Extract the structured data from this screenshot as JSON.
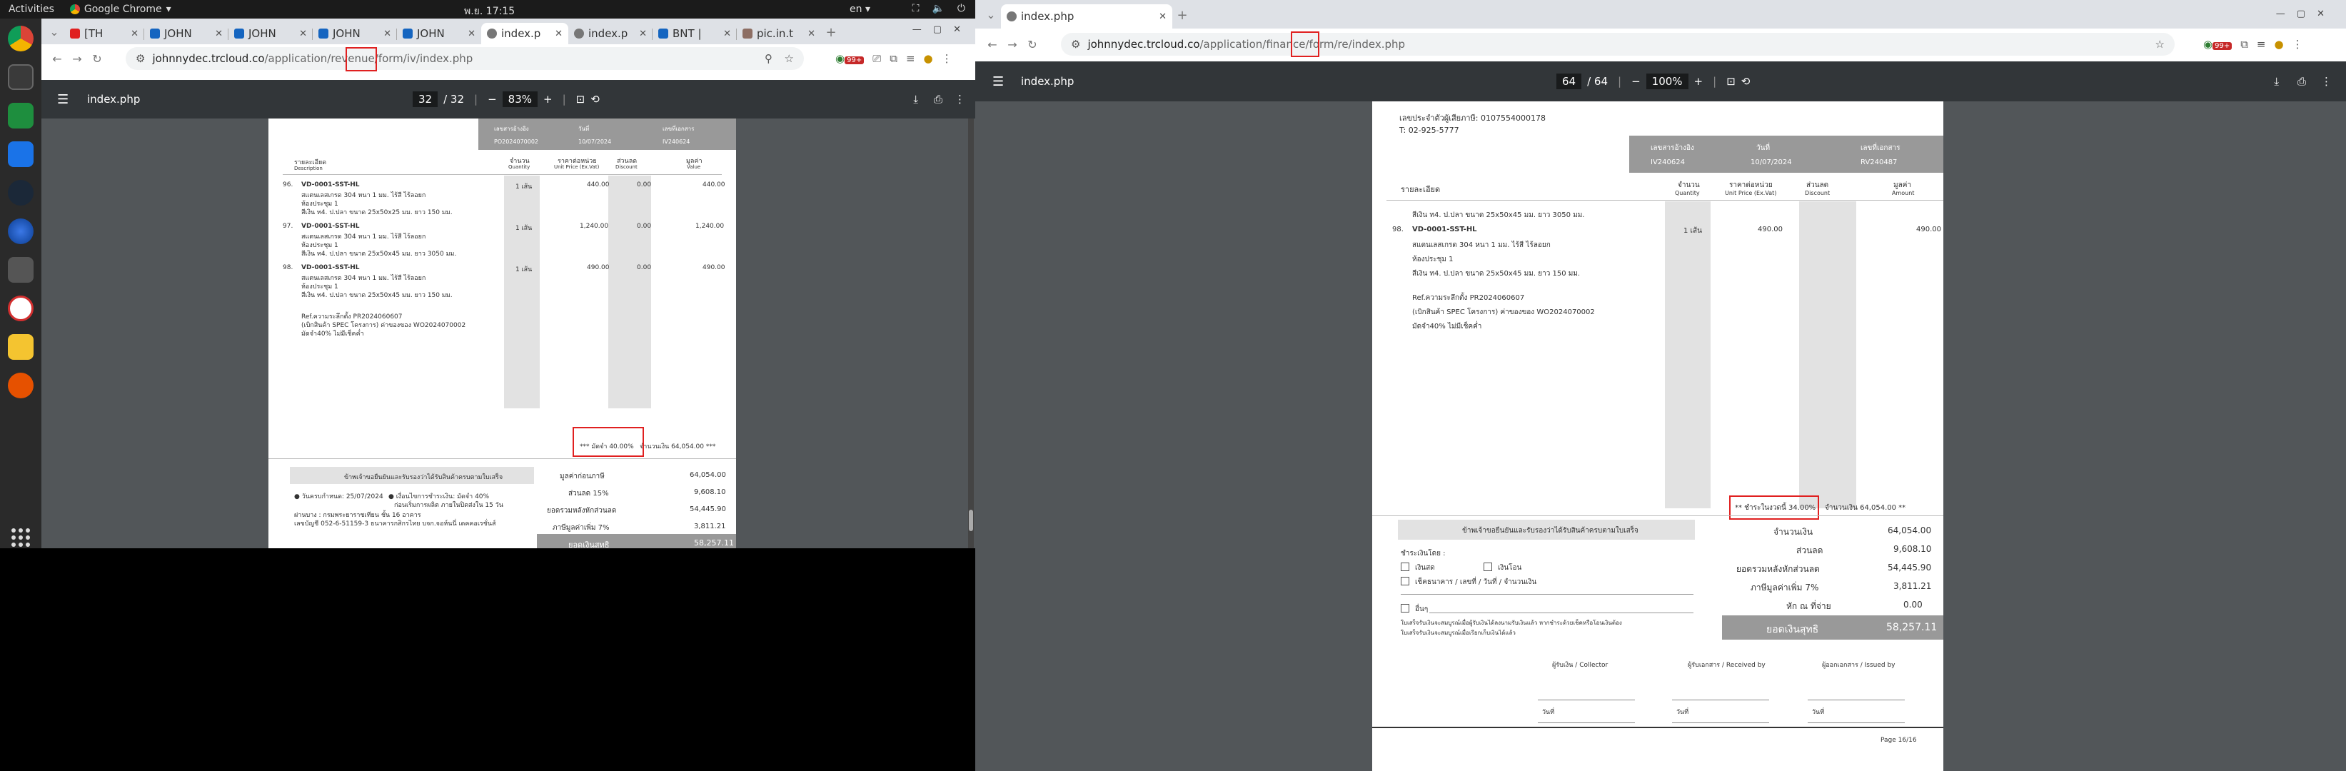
{
  "system": {
    "activities": "Activities",
    "app_name": "Google Chrome",
    "clock": "พ.ย. 17:15",
    "lang": "en"
  },
  "left": {
    "tabs": [
      {
        "label": "[TH",
        "color": "#e02020"
      },
      {
        "label": "JOHN",
        "color": "#1565c0"
      },
      {
        "label": "JOHN",
        "color": "#1565c0"
      },
      {
        "label": "JOHN",
        "color": "#1565c0"
      },
      {
        "label": "JOHN",
        "color": "#1565c0"
      },
      {
        "label": "index.p",
        "color": "#666"
      },
      {
        "label": "index.p",
        "color": "#666"
      },
      {
        "label": "BNT |",
        "color": "#1565c0"
      },
      {
        "label": "pic.in.t",
        "color": "#8d6e63"
      }
    ],
    "url_host": "johnnydec.trcloud.co",
    "url_path": "/application/revenue/form/iv/index.php",
    "pdf_title": "index.php",
    "page_current": "32",
    "page_total": "/ 32",
    "zoom": "83%",
    "doc": {
      "hdr_labels": [
        "เลขสารอ้างอิง",
        "วันที่",
        "เลขที่เอกสาร"
      ],
      "hdr_values": [
        "PO2024070002",
        "10/07/2024",
        "IV240624"
      ],
      "col_desc_th": "รายละเอียด",
      "col_desc_en": "Description",
      "col_qty_th": "จำนวน",
      "col_qty_en": "Quantity",
      "col_price_th": "ราคาต่อหน่วย",
      "col_price_en": "Unit Price (Ex.Vat)",
      "col_disc_th": "ส่วนลด",
      "col_disc_en": "Discount",
      "col_amt_th": "มูลค่า",
      "col_amt_en": "Value",
      "rows": [
        {
          "no": "96.",
          "code": "VD-0001-SST-HL",
          "l1": "สแตนเลสเกรด 304 หนา 1 มม. ไร้สี ไร้ลอยก",
          "l2": "ห้องประชุม 1",
          "l3": "สีเงิน ท4. ป.ปลา ขนาด 25x50x25 มม. ยาว 150 มม.",
          "qty": "1 เส้น",
          "price": "440.00",
          "disc": "0.00",
          "amt": "440.00"
        },
        {
          "no": "97.",
          "code": "VD-0001-SST-HL",
          "l1": "สแตนเลสเกรด 304 หนา 1 มม. ไร้สี ไร้ลอยก",
          "l2": "ห้องประชุม 1",
          "l3": "สีเงิน ท4. ป.ปลา ขนาด 25x50x45 มม. ยาว 3050 มม.",
          "qty": "1 เส้น",
          "price": "1,240.00",
          "disc": "0.00",
          "amt": "1,240.00"
        },
        {
          "no": "98.",
          "code": "VD-0001-SST-HL",
          "l1": "สแตนเลสเกรด 304 หนา 1 มม. ไร้สี ไร้ลอยก",
          "l2": "ห้องประชุม 1",
          "l3": "สีเงิน ท4. ป.ปลา ขนาด 25x50x45 มม. ยาว 150 มม.",
          "qty": "1 เส้น",
          "price": "490.00",
          "disc": "0.00",
          "amt": "490.00"
        }
      ],
      "note1": "Ref.ความระลึกตั้ง PR2024060607",
      "note2": "(เบิกสินค้า SPEC โครงการ) ค่าของของ WO2024070002",
      "note3": "มัดจำ40% ไม่มีเช็คค่ำ",
      "deposit_text": "*** มัดจำ 40.00%",
      "deposit_rest": "จำนวนเงิน 64,054.00 ***",
      "terms_title": "ข้าพเจ้าขอยืนยันและรับรองว่าได้รับสินค้าครบตามใบเสร็จ",
      "terms_a": "● วันครบกำหนด: 25/07/2024",
      "terms_b": "● เงื่อนไขการชำระเงิน: มัดจำ 40%",
      "terms_b2": "ก่อนเริ่มการผลิต ภายในปิดส่งใน 15 วัน",
      "terms_c": "ผ่านบาง : กรมพระยาราชเทียน ชั้น 16 อาคาร",
      "terms_d": "เลขบัญชี 052-6-51159-3 ธนาคารกสิกรไทย บจก.จอห์นนี่ เดคคอเรชั่นส์",
      "totals": [
        {
          "label": "มูลค่าก่อนภาษี",
          "value": "64,054.00"
        },
        {
          "label": "ส่วนลด 15%",
          "value": "9,608.10"
        },
        {
          "label": "ยอดรวมหลังหักส่วนลด",
          "value": "54,445.90"
        },
        {
          "label": "ภาษีมูลค่าเพิ่ม 7%",
          "value": "3,811.21"
        }
      ],
      "grand_label": "ยอดเงินสุทธิ",
      "grand_value": "58,257.11"
    }
  },
  "right": {
    "tab_label": "index.php",
    "url_host": "johnnydec.trcloud.co",
    "url_path": "/application/finance/form/re/index.php",
    "pdf_title": "index.php",
    "page_current": "64",
    "page_total": "/ 64",
    "zoom": "100%",
    "doc": {
      "tax_id": "เลขประจำตัวผู้เสียภาษี: 0107554000178",
      "phone": "T: 02-925-5777",
      "hdr_labels": [
        "เลขสารอ้างอิง",
        "วันที่",
        "เลขที่เอกสาร"
      ],
      "hdr_values": [
        "IV240624",
        "10/07/2024",
        "RV240487"
      ],
      "col_desc_th": "รายละเอียด",
      "col_qty_th": "จำนวน",
      "col_qty_en": "Quantity",
      "col_price_th": "ราคาต่อหน่วย",
      "col_price_en": "Unit Price (Ex.Vat)",
      "col_disc_th": "ส่วนลด",
      "col_disc_en": "Discount",
      "col_amt_th": "มูลค่า",
      "col_amt_en": "Amount",
      "pre_line": "สีเงิน ท4. ป.ปลา ขนาด 25x50x45 มม. ยาว 3050 มม.",
      "row": {
        "no": "98.",
        "code": "VD-0001-SST-HL",
        "l1": "สแตนเลสเกรด 304 หนา 1 มม. ไร้สี ไร้ลอยก",
        "l2": "ห้องประชุม 1",
        "l3": "สีเงิน ท4. ป.ปลา ขนาด 25x50x45 มม. ยาว 150 มม.",
        "qty": "1 เส้น",
        "price": "490.00",
        "amt": "490.00"
      },
      "note1": "Ref.ความระลึกตั้ง PR2024060607",
      "note2": "(เบิกสินค้า SPEC โครงการ) ค่าของของ WO2024070002",
      "note3": "มัดจำ40% ไม่มีเช็คค่ำ",
      "deposit_text": "** ชำระในงวดนี้ 34.00%",
      "deposit_rest": "จำนวนเงิน 64,054.00 **",
      "terms_title": "ข้าพเจ้าขอยืนยันและรับรองว่าได้รับสินค้าครบตามใบเสร็จ",
      "pay_by": "ชำระเงินโดย :",
      "opt_cash": "เงินสด",
      "opt_transfer": "เงินโอน",
      "opt_cheque": "เช็คธนาคาร / เลขที่ / วันที่ / จำนวนเงิน",
      "opt_other": "อื่นๆ",
      "fine1": "ใบเสร็จรับเงินจะสมบูรณ์เมื่อผู้รับเงินได้ลงนามรับเงินแล้ว หากชำระด้วยเช็คหรือโอนเงินต้อง",
      "fine2": "ใบเสร็จรับเงินจะสมบูรณ์เมื่อเรียกเก็บเงินได้แล้ว",
      "totals": [
        {
          "label": "จำนวนเงิน",
          "value": "64,054.00"
        },
        {
          "label": "ส่วนลด",
          "value": "9,608.10"
        },
        {
          "label": "ยอดรวมหลังหักส่วนลด",
          "value": "54,445.90"
        },
        {
          "label": "ภาษีมูลค่าเพิ่ม 7%",
          "value": "3,811.21"
        },
        {
          "label": "หัก ณ ที่จ่าย",
          "value": "0.00"
        }
      ],
      "grand_label": "ยอดเงินสุทธิ",
      "grand_value": "58,257.11",
      "sign": [
        "ผู้รับเงิน / Collector",
        "ผู้รับเอกสาร / Received by",
        "ผู้ออกเอกสาร / Issued by"
      ],
      "sign_date": "วันที่",
      "page_no": "Page 16/16"
    }
  }
}
